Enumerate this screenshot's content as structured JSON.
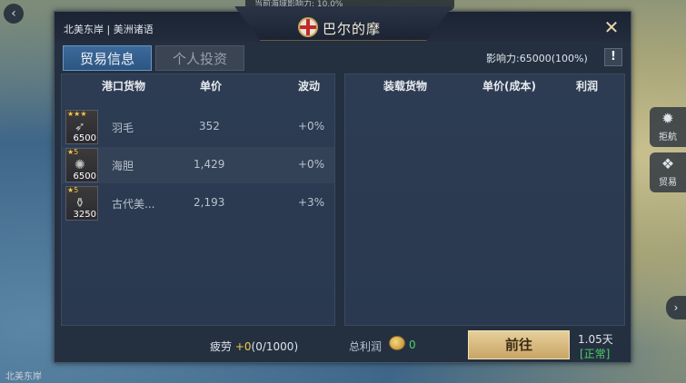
{
  "background": {
    "top_hint": "当前海域影响力: 10.0%",
    "side_buttons": [
      {
        "icon": "ship-wheel-icon",
        "label": "拒航"
      },
      {
        "icon": "money-bag-icon",
        "label": "贸易"
      }
    ],
    "bottom_left_text": "北美东岸"
  },
  "dialog": {
    "region": "北美东岸 | 美洲诸语",
    "title": "巴尔的摩",
    "close_icon": "close-x-icon",
    "tabs": [
      {
        "label": "贸易信息",
        "active": true
      },
      {
        "label": "个人投资",
        "active": false
      }
    ],
    "influence": "影响力:65000(100%)",
    "info_label": "!",
    "port_goods": {
      "headers": [
        "港口货物",
        "单价",
        "波动"
      ],
      "rows": [
        {
          "stars": "★★★",
          "icon": "feather-icon",
          "qty": "6500",
          "name": "羽毛",
          "price": "352",
          "change": "+0%"
        },
        {
          "stars": "★5",
          "icon": "sea-urchin-icon",
          "qty": "6500",
          "name": "海胆",
          "price": "1,429",
          "change": "+0%"
        },
        {
          "stars": "★5",
          "icon": "ancient-vase-icon",
          "qty": "3250",
          "name": "古代美...",
          "price": "2,193",
          "change": "+3%"
        }
      ]
    },
    "loaded_goods": {
      "headers": [
        "装载货物",
        "单价(成本)",
        "利润"
      ],
      "rows": []
    },
    "footer": {
      "fatigue_label": "疲劳",
      "fatigue_plus": "+0",
      "fatigue_value": "(0/1000)",
      "total_profit_label": "总利润",
      "total_profit_value": "0",
      "go_button": "前往",
      "eta": "1.05天",
      "status": "[正常]"
    },
    "colors": {
      "accent_blue": "#2c5682",
      "gold": "#c9a566",
      "positive_green": "#4fd06a"
    }
  }
}
